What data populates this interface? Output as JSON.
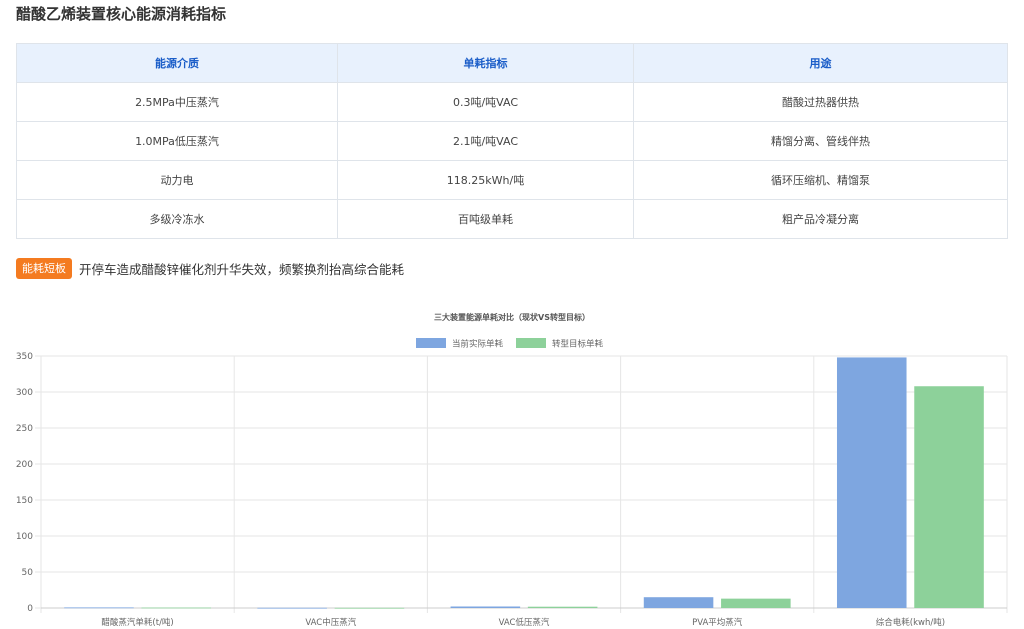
{
  "page": {
    "title": "醋酸乙烯装置核心能源消耗指标"
  },
  "table": {
    "headers": [
      "能源介质",
      "单耗指标",
      "用途"
    ],
    "rows": [
      [
        "2.5MPa中压蒸汽",
        "0.3吨/吨VAC",
        "醋酸过热器供热"
      ],
      [
        "1.0MPa低压蒸汽",
        "2.1吨/吨VAC",
        "精馏分离、管线伴热"
      ],
      [
        "动力电",
        "118.25kWh/吨",
        "循环压缩机、精馏泵"
      ],
      [
        "多级冷冻水",
        "百吨级单耗",
        "粗产品冷凝分离"
      ]
    ]
  },
  "note": {
    "badge": "能耗短板",
    "text": "开停车造成醋酸锌催化剂升华失效，频繁换剂抬高综合能耗",
    "badge_color": "#f47b20"
  },
  "chart_data": {
    "type": "bar",
    "title": "三大装置能源单耗对比（现状VS转型目标）",
    "categories": [
      "醋酸蒸汽单耗(t/吨)",
      "VAC中压蒸汽",
      "VAC低压蒸汽",
      "PVA平均蒸汽",
      "综合电耗(kwh/吨)"
    ],
    "series": [
      {
        "name": "当前实际单耗",
        "values": [
          0.8,
          0.3,
          2.1,
          15,
          348
        ],
        "color": "#7ea6e0"
      },
      {
        "name": "转型目标单耗",
        "values": [
          0.6,
          0.25,
          1.8,
          13,
          308
        ],
        "color": "#8dd19a"
      }
    ],
    "yticks": [
      0,
      50,
      100,
      150,
      200,
      250,
      300,
      350
    ],
    "ylim": [
      0,
      350
    ],
    "legend_position": "top-center",
    "grid": true
  }
}
